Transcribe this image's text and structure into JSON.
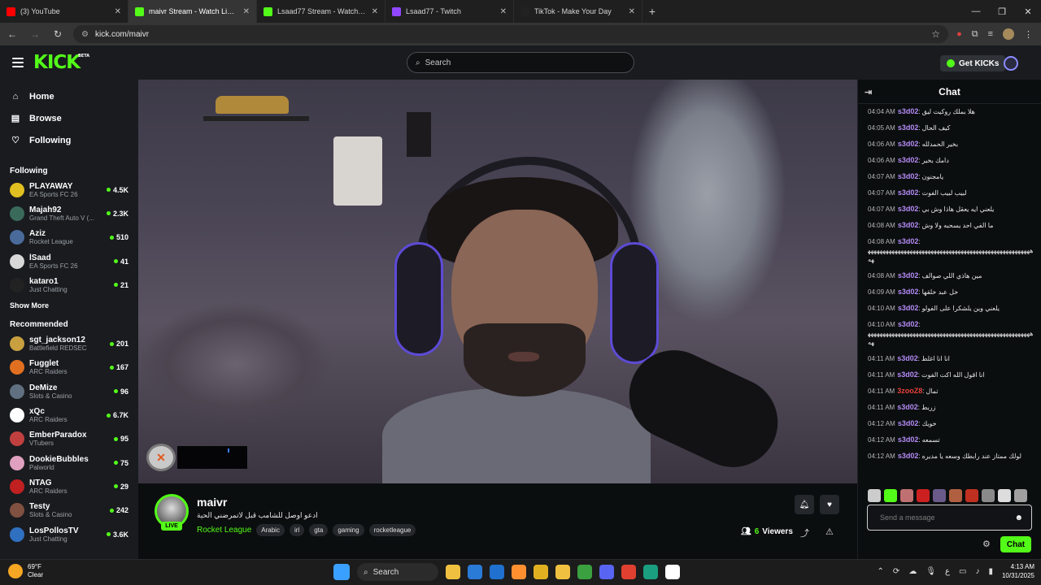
{
  "browser": {
    "tabs": [
      {
        "label": "(3) YouTube",
        "color": "#ff0000"
      },
      {
        "label": "maivr Stream - Watch Live on Kick",
        "color": "#53fc18",
        "active": true
      },
      {
        "label": "Lsaad77 Stream - Watch Live on Kick",
        "color": "#53fc18"
      },
      {
        "label": "Lsaad77 - Twitch",
        "color": "#9146ff"
      },
      {
        "label": "TikTok - Make Your Day",
        "color": "#222222"
      }
    ],
    "url": "kick.com/maivr"
  },
  "header": {
    "logo": "KICK",
    "logo_beta": "BETA",
    "search_placeholder": "Search",
    "get_kicks_label": "Get KICKs"
  },
  "sidebar": {
    "nav": [
      {
        "label": "Home",
        "icon": "home-icon",
        "glyph": "⌂"
      },
      {
        "label": "Browse",
        "icon": "browse-icon",
        "glyph": "▤"
      },
      {
        "label": "Following",
        "icon": "heart-icon",
        "glyph": "♡"
      }
    ],
    "following_heading": "Following",
    "following": [
      {
        "name": "PLAYAWAY",
        "category": "EA Sports FC 26",
        "viewers": "4.5K",
        "color": "#e0c020"
      },
      {
        "name": "Majah92",
        "category": "Grand Theft Auto V (...",
        "viewers": "2.3K",
        "color": "#3a6a5a"
      },
      {
        "name": "Aziz",
        "category": "Rocket League",
        "viewers": "510",
        "color": "#4a6a9a"
      },
      {
        "name": "lSaad",
        "category": "EA Sports FC 26",
        "viewers": "41",
        "color": "#d8d8d8"
      },
      {
        "name": "kataro1",
        "category": "Just Chatting",
        "viewers": "21",
        "color": "#222222"
      }
    ],
    "show_more": "Show More",
    "recommended_heading": "Recommended",
    "recommended": [
      {
        "name": "sgt_jackson12",
        "category": "Battlefield REDSEC",
        "viewers": "201",
        "color": "#c8a040"
      },
      {
        "name": "Fugglet",
        "category": "ARC Raiders",
        "viewers": "167",
        "color": "#e07020"
      },
      {
        "name": "DeMize",
        "category": "Slots & Casino",
        "viewers": "96",
        "color": "#607080"
      },
      {
        "name": "xQc",
        "category": "ARC Raiders",
        "viewers": "6.7K",
        "color": "#ffffff"
      },
      {
        "name": "EmberParadox",
        "category": "VTubers",
        "viewers": "95",
        "color": "#c04040"
      },
      {
        "name": "DookieBubbles",
        "category": "Palworld",
        "viewers": "75",
        "color": "#e0a0c0"
      },
      {
        "name": "NTAG",
        "category": "ARC Raiders",
        "viewers": "29",
        "color": "#c02020"
      },
      {
        "name": "Testy",
        "category": "Slots & Casino",
        "viewers": "242",
        "color": "#805040"
      },
      {
        "name": "LosPollosTV",
        "category": "Just Chatting",
        "viewers": "3.6K",
        "color": "#3070c0"
      }
    ]
  },
  "stream": {
    "streamer": "maivr",
    "title": "ادعو اوصل للشامب قبل لاتمرضني الحية",
    "live_badge": "LIVE",
    "category": "Rocket League",
    "tags": [
      "Arabic",
      "irl",
      "gta",
      "gaming",
      "rocketleague"
    ],
    "viewer_count": "6",
    "viewers_label": "Viewers"
  },
  "chat": {
    "title": "Chat",
    "messages": [
      {
        "ts": "04:04 AM",
        "user": "s3d02",
        "text": "هلا بملك روكيت ليق"
      },
      {
        "ts": "04:05 AM",
        "user": "s3d02",
        "text": "كيف الحال"
      },
      {
        "ts": "04:06 AM",
        "user": "s3d02",
        "text": "بخير الحمدلله"
      },
      {
        "ts": "04:06 AM",
        "user": "s3d02",
        "text": "دامك بخير"
      },
      {
        "ts": "04:07 AM",
        "user": "s3d02",
        "text": "يامجنون"
      },
      {
        "ts": "04:07 AM",
        "user": "s3d02",
        "text": "لبيب لبيب الفوت"
      },
      {
        "ts": "04:07 AM",
        "user": "s3d02",
        "text": "يلعني ايه يعقل هاذا وش بي"
      },
      {
        "ts": "04:08 AM",
        "user": "s3d02",
        "text": "ما الفي احد يسحبه ولا وش"
      },
      {
        "ts": "04:08 AM",
        "user": "s3d02",
        "text": "",
        "long": "ههههههههههههههههههههههههههههههههههههههههههههههههههههههههه"
      },
      {
        "ts": "04:08 AM",
        "user": "s3d02",
        "text": "مين هاذي اللي صوالف"
      },
      {
        "ts": "04:09 AM",
        "user": "s3d02",
        "text": "خل عبد خلقها"
      },
      {
        "ts": "04:10 AM",
        "user": "s3d02",
        "text": "يلعني وين يلشكرا على الفولو"
      },
      {
        "ts": "04:10 AM",
        "user": "s3d02",
        "text": "",
        "long": "ههههههههههههههههههههههههههههههههههههههههههههههههههههههههه"
      },
      {
        "ts": "04:11 AM",
        "user": "s3d02",
        "text": "انا انا اغلط"
      },
      {
        "ts": "04:11 AM",
        "user": "s3d02",
        "text": "انا اقول الله اكت الفوت"
      },
      {
        "ts": "04:11 AM",
        "user": "3zooZ8",
        "text": "تمال",
        "red": true
      },
      {
        "ts": "04:11 AM",
        "user": "s3d02",
        "text": "زربط"
      },
      {
        "ts": "04:12 AM",
        "user": "s3d02",
        "text": "خويك"
      },
      {
        "ts": "04:12 AM",
        "user": "s3d02",
        "text": "تسمعه"
      },
      {
        "ts": "04:12 AM",
        "user": "s3d02",
        "text": "لولك ممتاز عند رابطك وسعه يا مديره"
      }
    ],
    "emote_colors": [
      "#cccccc",
      "#53fc18",
      "#c07070",
      "#cc2020",
      "#6a5a8a",
      "#b06040",
      "#c03020",
      "#8a8a8a",
      "#dddddd",
      "#a0a0a0"
    ],
    "input_placeholder": "Send a message",
    "send_label": "Chat"
  },
  "taskbar": {
    "temperature": "69°F",
    "condition": "Clear",
    "search_label": "Search",
    "app_colors": [
      "#f0c040",
      "#2a7ad8",
      "#2070d0",
      "#ff9030",
      "#e0b020",
      "#f0c040",
      "#3aa040",
      "#5865f2",
      "#e04030",
      "#1aa080",
      "#ffffff"
    ],
    "time": "4:13 AM",
    "date": "10/31/2025"
  }
}
